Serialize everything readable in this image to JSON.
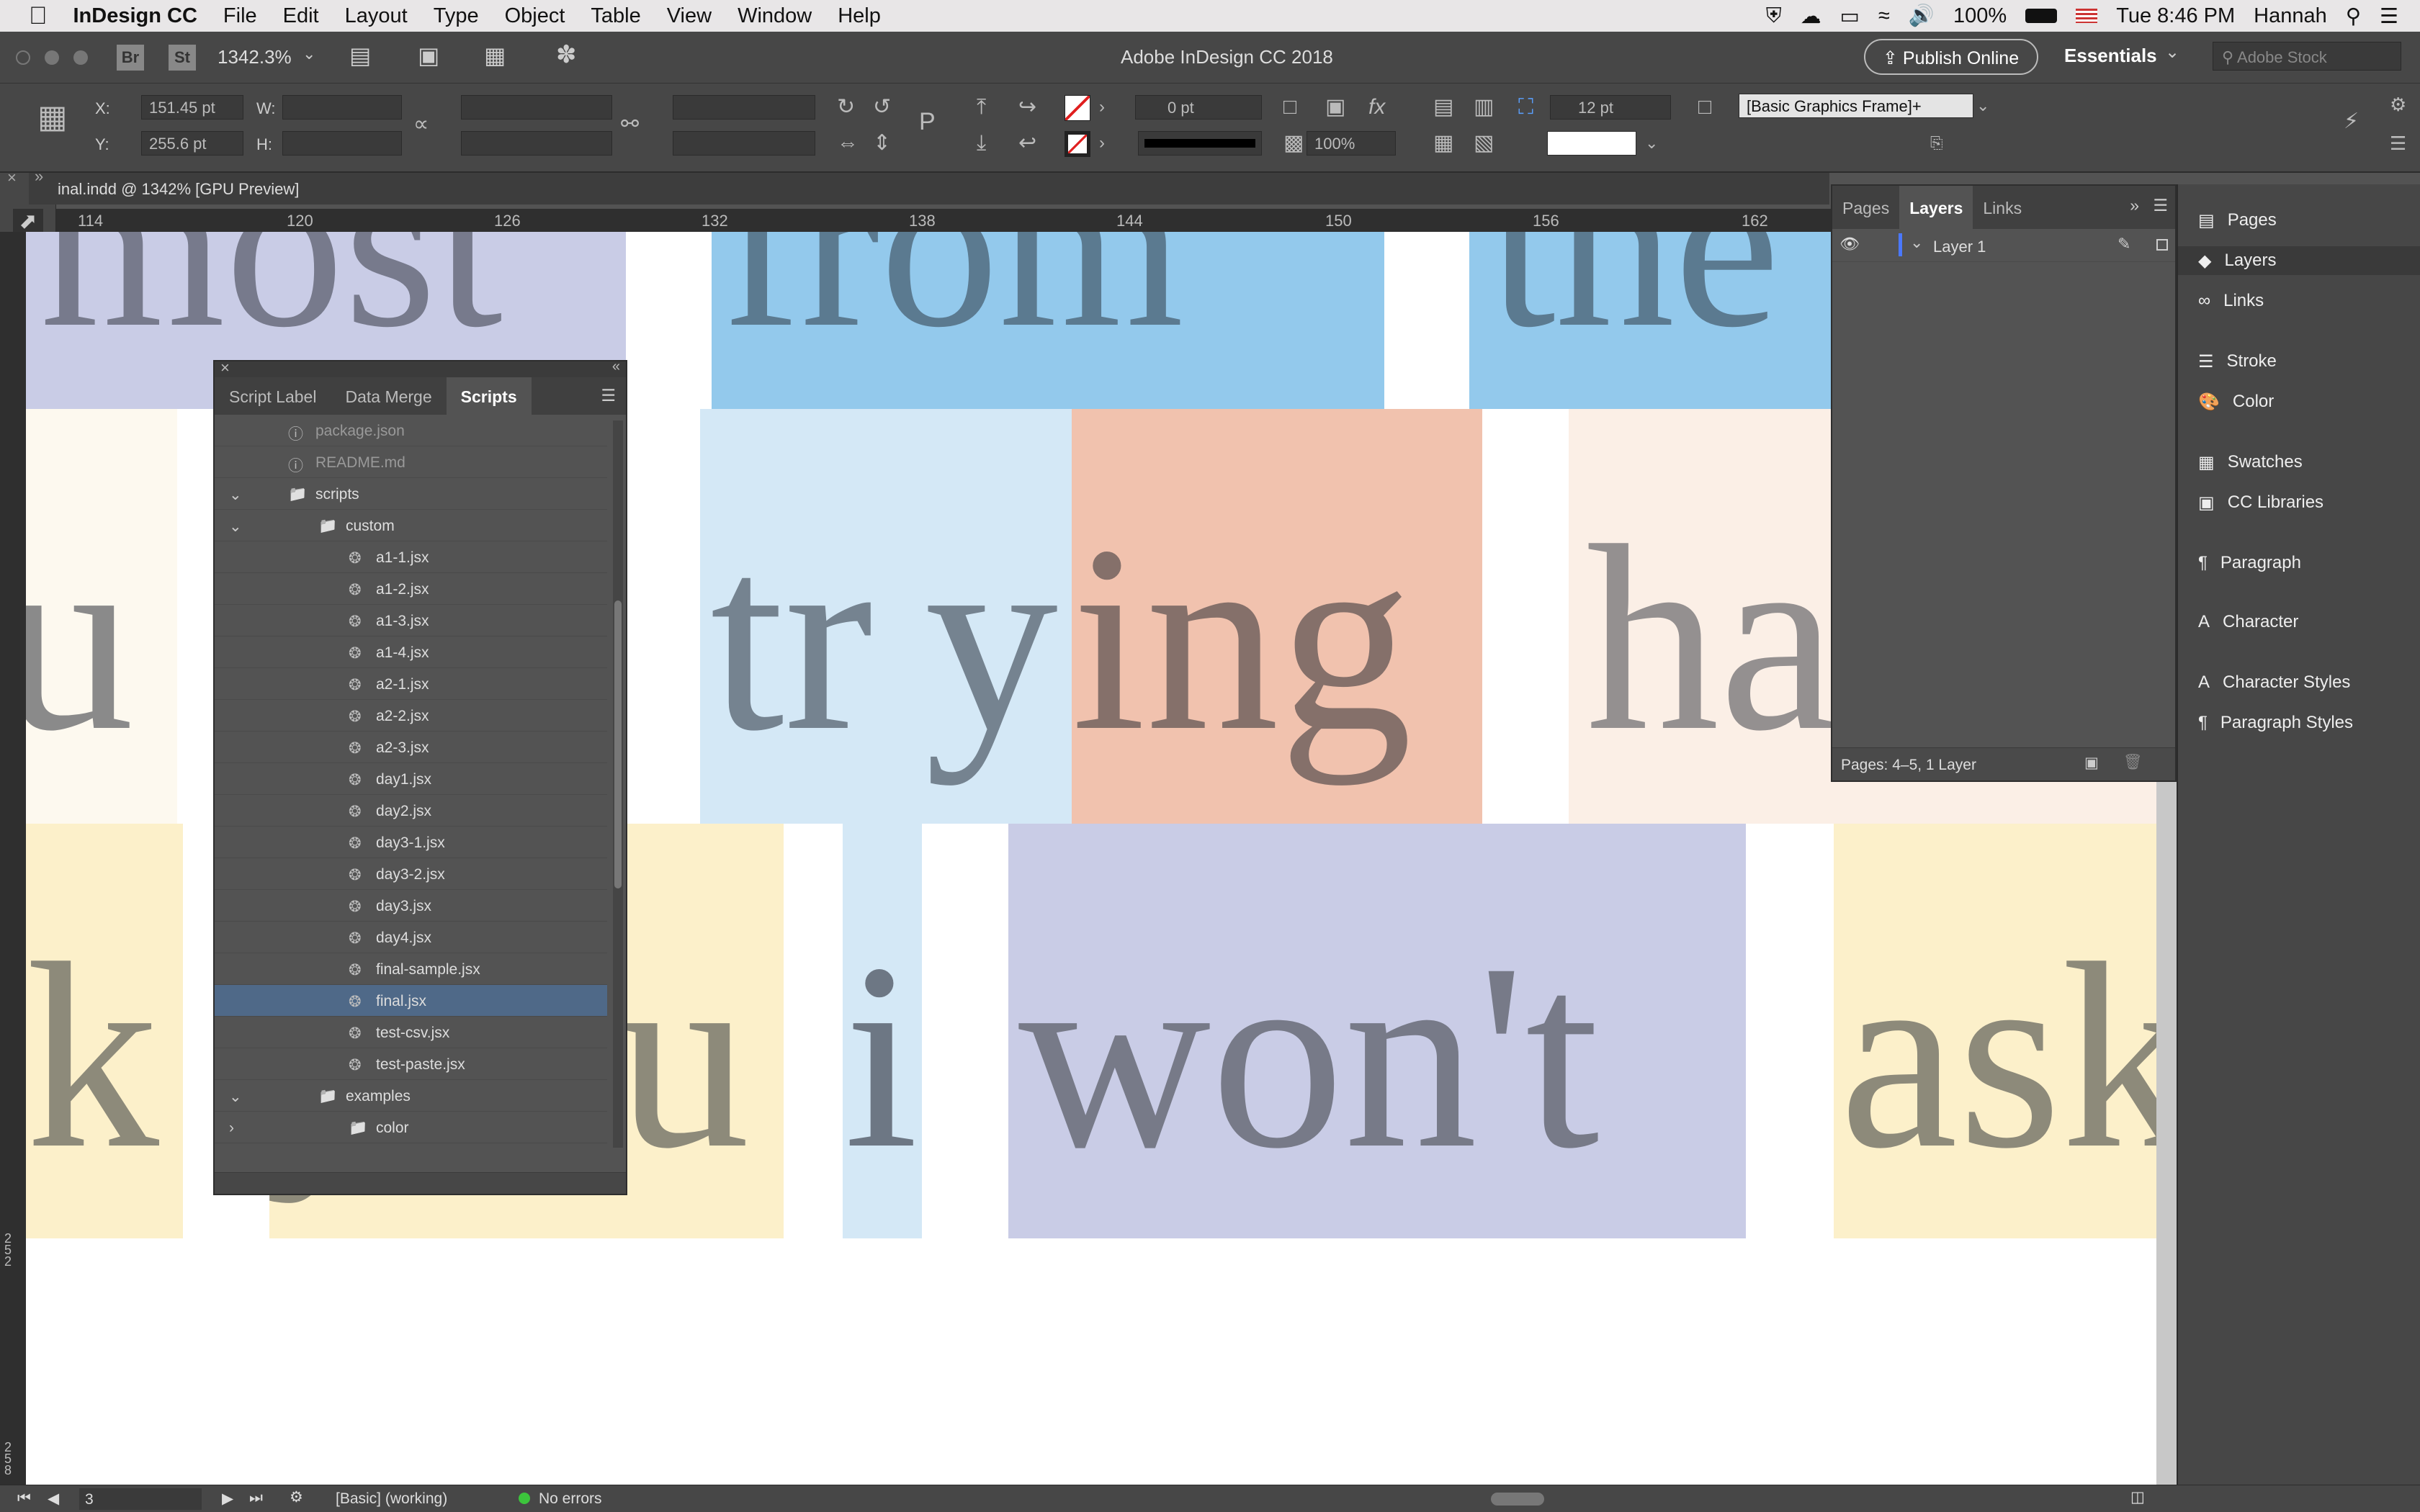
{
  "menubar": {
    "app": "InDesign CC",
    "items": [
      "File",
      "Edit",
      "Layout",
      "Type",
      "Object",
      "Table",
      "View",
      "Window",
      "Help"
    ],
    "battery": "100%",
    "clock": "Tue 8:46 PM",
    "user": "Hannah"
  },
  "appbar": {
    "bridge": "Br",
    "stock": "St",
    "zoom": "1342.3%",
    "title": "Adobe InDesign CC 2018",
    "publish": "Publish Online",
    "workspace": "Essentials",
    "search_placeholder": "Adobe Stock"
  },
  "control": {
    "x_label": "X:",
    "x_value": "151.45 pt",
    "y_label": "Y:",
    "y_value": "255.6 pt",
    "w_label": "W:",
    "h_label": "H:",
    "stroke_weight": "0 pt",
    "opacity": "100%",
    "corner_size": "12 pt",
    "object_style": "[Basic Graphics Frame]+"
  },
  "document": {
    "tab_title": "inal.indd @ 1342% [GPU Preview]",
    "ruler_ticks": [
      "114",
      "120",
      "126",
      "132",
      "138",
      "144",
      "150",
      "156",
      "162"
    ],
    "vruler_ticks": [
      "2 5 2",
      "2 5 8"
    ]
  },
  "canvas": {
    "rows": [
      {
        "words": [
          "most",
          "from",
          "the"
        ]
      },
      {
        "words": [
          "ou",
          "tr",
          "y",
          "ing",
          "ha"
        ]
      },
      {
        "words": [
          "k",
          "y",
          "u",
          "i",
          "won't",
          "ask"
        ]
      }
    ]
  },
  "scripts_panel": {
    "tabs": [
      "Script Label",
      "Data Merge",
      "Scripts"
    ],
    "items": [
      {
        "label": "package.json",
        "type": "info",
        "depth": 2
      },
      {
        "label": "README.md",
        "type": "info",
        "depth": 2
      },
      {
        "label": "scripts",
        "type": "folder",
        "depth": 2,
        "expanded": true
      },
      {
        "label": "custom",
        "type": "folder",
        "depth": 3,
        "expanded": true
      },
      {
        "label": "a1-1.jsx",
        "type": "script",
        "depth": 4
      },
      {
        "label": "a1-2.jsx",
        "type": "script",
        "depth": 4
      },
      {
        "label": "a1-3.jsx",
        "type": "script",
        "depth": 4
      },
      {
        "label": "a1-4.jsx",
        "type": "script",
        "depth": 4
      },
      {
        "label": "a2-1.jsx",
        "type": "script",
        "depth": 4
      },
      {
        "label": "a2-2.jsx",
        "type": "script",
        "depth": 4
      },
      {
        "label": "a2-3.jsx",
        "type": "script",
        "depth": 4
      },
      {
        "label": "day1.jsx",
        "type": "script",
        "depth": 4
      },
      {
        "label": "day2.jsx",
        "type": "script",
        "depth": 4
      },
      {
        "label": "day3-1.jsx",
        "type": "script",
        "depth": 4
      },
      {
        "label": "day3-2.jsx",
        "type": "script",
        "depth": 4
      },
      {
        "label": "day3.jsx",
        "type": "script",
        "depth": 4
      },
      {
        "label": "day4.jsx",
        "type": "script",
        "depth": 4
      },
      {
        "label": "final-sample.jsx",
        "type": "script",
        "depth": 4
      },
      {
        "label": "final.jsx",
        "type": "script",
        "depth": 4,
        "selected": true
      },
      {
        "label": "test-csv.jsx",
        "type": "script",
        "depth": 4
      },
      {
        "label": "test-paste.jsx",
        "type": "script",
        "depth": 4
      },
      {
        "label": "examples",
        "type": "folder",
        "depth": 3,
        "expanded": true
      },
      {
        "label": "color",
        "type": "folder",
        "depth": 4,
        "expanded": false
      }
    ]
  },
  "layers_panel": {
    "tabs": [
      "Pages",
      "Layers",
      "Links"
    ],
    "layer": "Layer 1",
    "footer": "Pages: 4–5, 1 Layer"
  },
  "dock": {
    "items": [
      "Pages",
      "Layers",
      "Links",
      "Stroke",
      "Color",
      "Swatches",
      "CC Libraries",
      "Paragraph",
      "Character",
      "Character Styles",
      "Paragraph Styles"
    ]
  },
  "status": {
    "page": "3",
    "preflight_profile": "[Basic] (working)",
    "errors": "No errors"
  },
  "colors": {
    "ui_bg": "#535353",
    "selection": "#4f6988",
    "lavender": "#c9cce6",
    "sky": "#93c9ec",
    "pale_blue": "#d4e8f6",
    "salmon": "#f1c2ae",
    "cream": "#fcf0ca",
    "peach": "#fbefe6"
  }
}
